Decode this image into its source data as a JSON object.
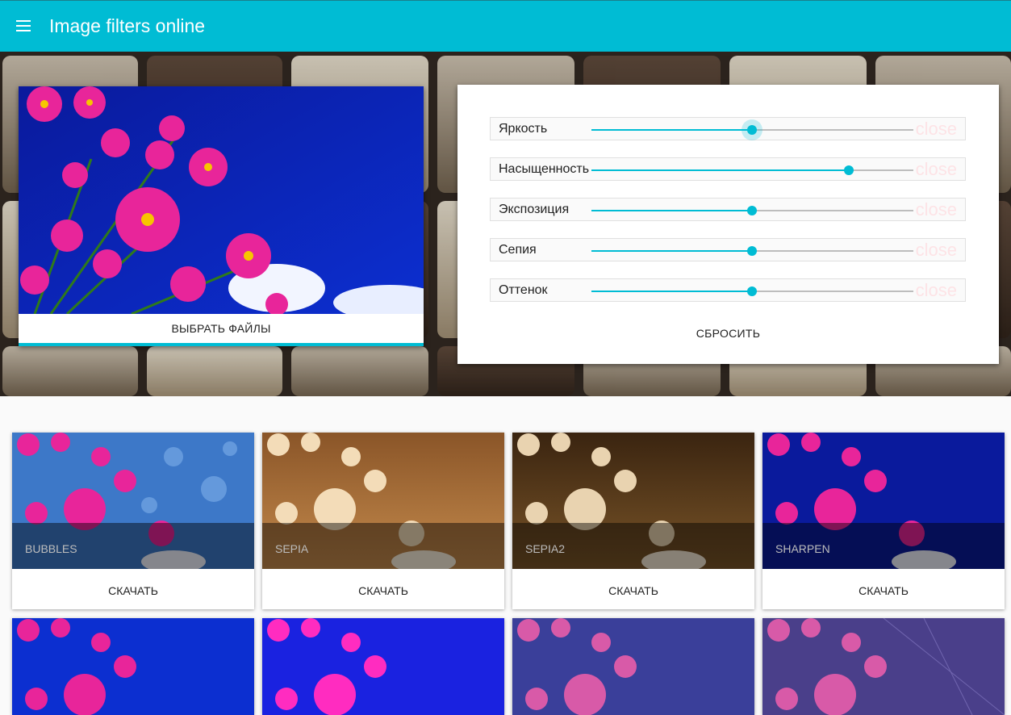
{
  "appbar": {
    "title": "Image filters online"
  },
  "preview": {
    "choose_label": "ВЫБРАТЬ ФАЙЛЫ"
  },
  "controls": {
    "sliders": [
      {
        "label": "Яркость",
        "value": 0.5,
        "close": "close"
      },
      {
        "label": "Насыщенность",
        "value": 0.8,
        "close": "close"
      },
      {
        "label": "Экспозиция",
        "value": 0.5,
        "close": "close"
      },
      {
        "label": "Сепия",
        "value": 0.5,
        "close": "close"
      },
      {
        "label": "Оттенок",
        "value": 0.5,
        "close": "close"
      }
    ],
    "reset_label": "СБРОСИТЬ"
  },
  "gallery": {
    "download_label": "СКАЧАТЬ",
    "filters": [
      {
        "name": "BUBBLES"
      },
      {
        "name": "SEPIA"
      },
      {
        "name": "SEPIA2"
      },
      {
        "name": "SHARPEN"
      }
    ]
  },
  "colors": {
    "accent": "#00bcd4",
    "close_text": "#fde3e6"
  }
}
